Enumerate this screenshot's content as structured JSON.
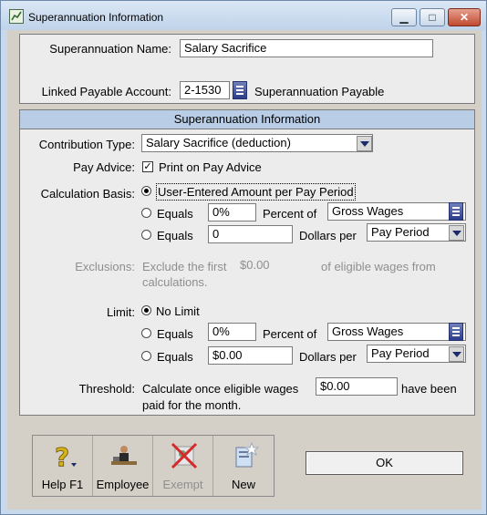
{
  "window": {
    "title": "Superannuation Information",
    "controls": {
      "minimize": "▁",
      "maximize": "□",
      "close": "✕"
    }
  },
  "header": {
    "name_label": "Superannuation Name:",
    "name_value": "Salary Sacrifice",
    "linked_label": "Linked Payable Account:",
    "linked_value": "2-1530",
    "linked_account_name": "Superannuation Payable"
  },
  "section": {
    "title": "Superannuation Information",
    "contribution_type_label": "Contribution Type:",
    "contribution_type_value": "Salary Sacrifice (deduction)",
    "pay_advice_label": "Pay Advice:",
    "pay_advice_option": "Print on Pay Advice",
    "calc_basis_label": "Calculation Basis:",
    "calc_option_user": "User-Entered Amount per Pay Period",
    "calc_percent_equals": "Equals",
    "calc_percent_value": "0%",
    "calc_percent_of": "Percent of",
    "calc_percent_base": "Gross Wages",
    "calc_dollars_equals": "Equals",
    "calc_dollars_value": "0",
    "calc_dollars_per": "Dollars per",
    "calc_dollars_period": "Pay Period",
    "exclusions_label": "Exclusions:",
    "exclusions_text1": "Exclude the first",
    "exclusions_amount": "$0.00",
    "exclusions_text2": "of eligible wages from",
    "exclusions_text3": "calculations.",
    "limit_label": "Limit:",
    "limit_none": "No Limit",
    "limit_percent_equals": "Equals",
    "limit_percent_value": "0%",
    "limit_percent_of": "Percent of",
    "limit_percent_base": "Gross Wages",
    "limit_dollars_equals": "Equals",
    "limit_dollars_value": "$0.00",
    "limit_dollars_per": "Dollars per",
    "limit_dollars_period": "Pay Period",
    "threshold_label": "Threshold:",
    "threshold_text1": "Calculate once eligible wages",
    "threshold_value": "$0.00",
    "threshold_text2": "have been",
    "threshold_text3": "paid for the month."
  },
  "toolbar": {
    "help": "Help F1",
    "employee": "Employee",
    "exempt": "Exempt",
    "new": "New"
  },
  "ok_label": "OK"
}
